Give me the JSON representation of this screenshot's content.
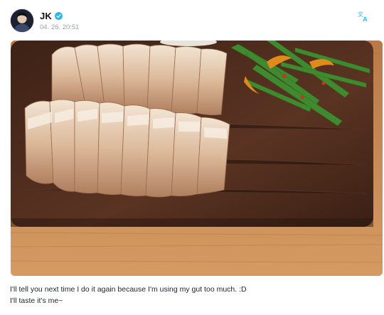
{
  "post": {
    "author": {
      "name": "JK",
      "verified": true,
      "avatar_icon": "user-avatar"
    },
    "timestamp": "04. 26. 20:51",
    "translate_icon": "translate-icon",
    "media": {
      "type": "photo"
    },
    "caption": {
      "line1": "I'll tell you next time I do it again because I'm using my gut too much. :D",
      "line2": "I'll taste it's me~"
    }
  },
  "colors": {
    "verified_badge": "#2fb8e6",
    "translate_icon": "#2fb8e6",
    "wood_table": "#c88a55",
    "cutting_board": "#4a2a1c"
  }
}
